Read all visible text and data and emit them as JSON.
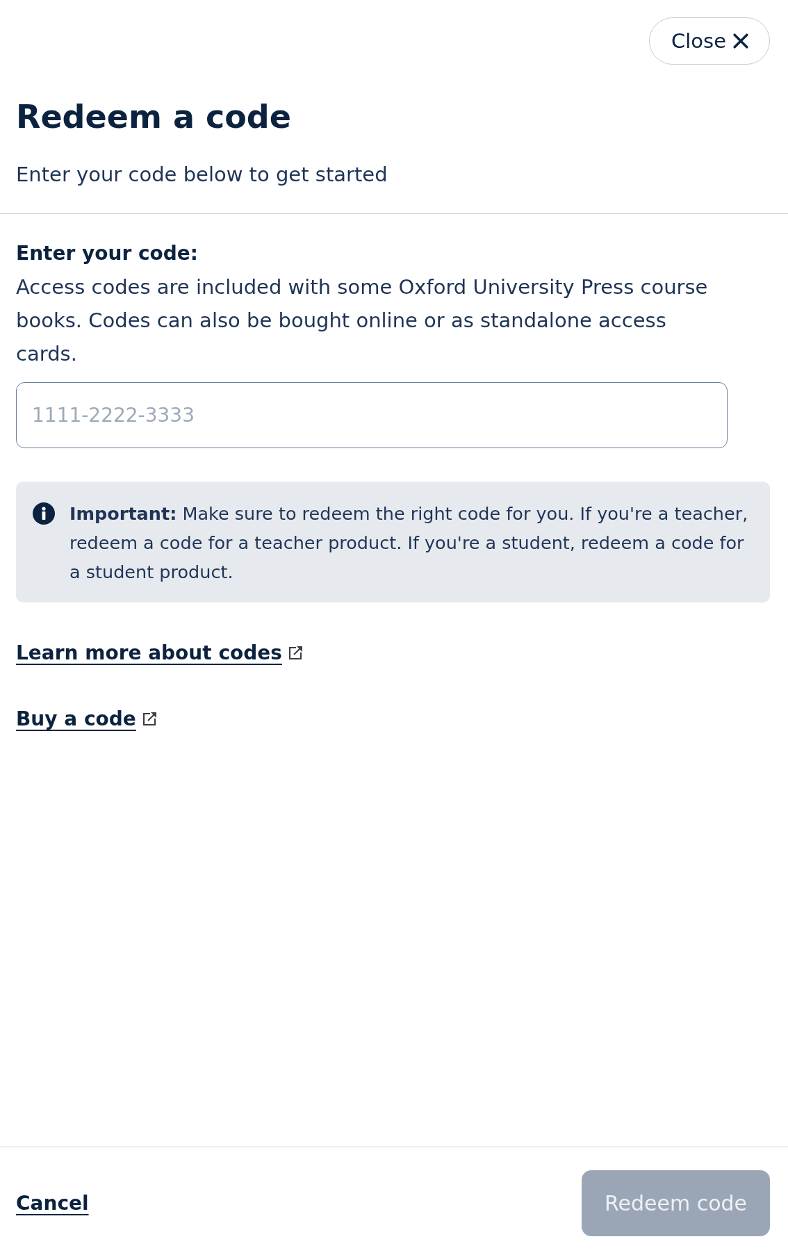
{
  "close_button": {
    "label": "Close"
  },
  "title": "Redeem a code",
  "subtitle": "Enter your code below to get started",
  "code_field": {
    "label": "Enter your code:",
    "description": "Access codes are included with some Oxford University Press course books. Codes can also be bought online or as standalone access cards.",
    "placeholder": "1111-2222-3333"
  },
  "notice": {
    "text": "**Important:** Make sure to redeem the right code for you. If you're a teacher, redeem a code for a teacher product. If you're a student, redeem a code for a student product."
  },
  "links": [
    {
      "label": "Learn more about codes",
      "external": true
    },
    {
      "label": "Buy a code",
      "external": true
    }
  ],
  "footer": {
    "cancel": "Cancel",
    "submit": {
      "label": "Redeem code",
      "disabled": true
    }
  }
}
